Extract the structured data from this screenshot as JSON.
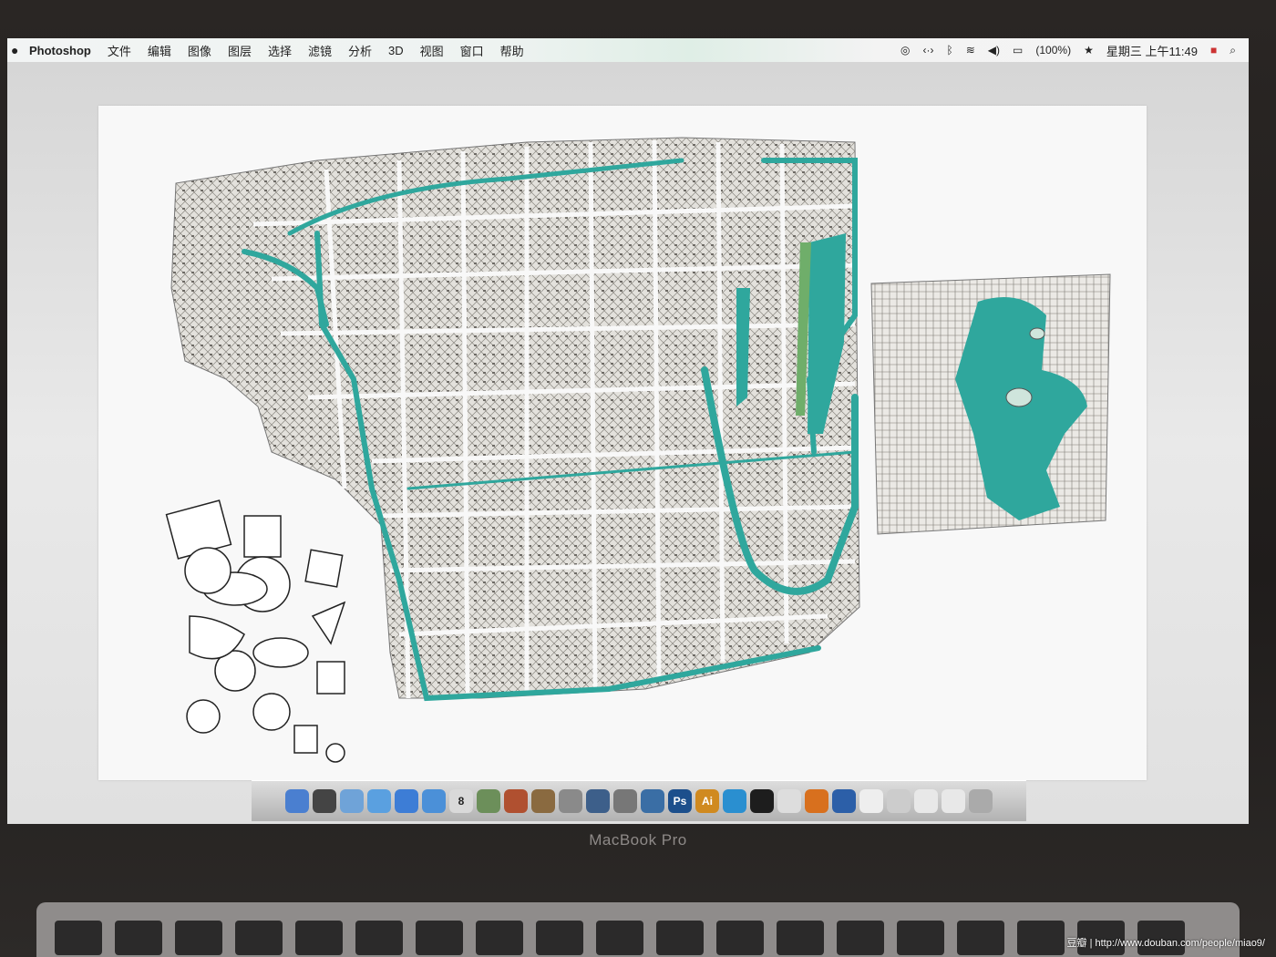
{
  "menubar": {
    "app": "Photoshop",
    "items": [
      "文件",
      "编辑",
      "图像",
      "图层",
      "选择",
      "滤镜",
      "分析",
      "3D",
      "视图",
      "窗口",
      "帮助"
    ],
    "battery": "(100%)",
    "clock": "星期三 上午11:49"
  },
  "dock": {
    "icons": [
      {
        "name": "finder",
        "color": "#4a7fd0",
        "label": ""
      },
      {
        "name": "dashboard",
        "color": "#444",
        "label": ""
      },
      {
        "name": "mail",
        "color": "#6fa3d8",
        "label": ""
      },
      {
        "name": "ichat",
        "color": "#5aa0e0",
        "label": ""
      },
      {
        "name": "itunes",
        "color": "#3d7dd6",
        "label": ""
      },
      {
        "name": "safari",
        "color": "#4b90d8",
        "label": ""
      },
      {
        "name": "ical",
        "color": "#d9d9d9",
        "label": "8"
      },
      {
        "name": "iphoto",
        "color": "#6c8f5a",
        "label": ""
      },
      {
        "name": "photo-booth",
        "color": "#b05030",
        "label": ""
      },
      {
        "name": "garageband",
        "color": "#8a6a40",
        "label": ""
      },
      {
        "name": "sync",
        "color": "#8a8a8a",
        "label": ""
      },
      {
        "name": "spaces",
        "color": "#3d5f8a",
        "label": ""
      },
      {
        "name": "preview",
        "color": "#777",
        "label": ""
      },
      {
        "name": "time-machine",
        "color": "#3a6ea5",
        "label": ""
      },
      {
        "name": "photoshop",
        "color": "#1c4f8c",
        "label": "Ps"
      },
      {
        "name": "illustrator",
        "color": "#d08a20",
        "label": "Ai"
      },
      {
        "name": "messenger",
        "color": "#2a8fd0",
        "label": ""
      },
      {
        "name": "qq",
        "color": "#1d1d1d",
        "label": ""
      },
      {
        "name": "textedit",
        "color": "#ddd",
        "label": ""
      },
      {
        "name": "firefox",
        "color": "#d8701e",
        "label": ""
      },
      {
        "name": "google-earth",
        "color": "#2c5fa8",
        "label": ""
      },
      {
        "name": "document",
        "color": "#eee",
        "label": ""
      },
      {
        "name": "downloads",
        "color": "#ccc",
        "label": ""
      },
      {
        "name": "image-file",
        "color": "#e8e8e8",
        "label": ""
      },
      {
        "name": "image-file-2",
        "color": "#e8e8e8",
        "label": ""
      },
      {
        "name": "trash",
        "color": "#aaa",
        "label": ""
      }
    ]
  },
  "laptop": {
    "brand": "MacBook Pro"
  },
  "watermark": "豆瓣 | http://www.douban.com/people/miao9/",
  "colors": {
    "water": "#2fa79d",
    "park": "#6fae6a"
  }
}
